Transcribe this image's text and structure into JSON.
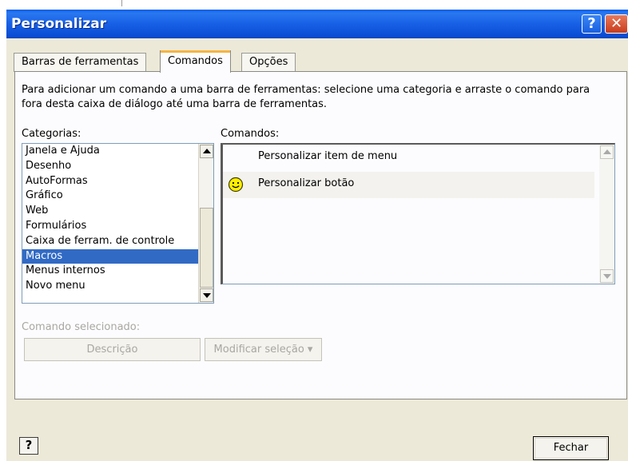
{
  "window": {
    "title": "Personalizar",
    "help_glyph": "?",
    "close_glyph": "✕"
  },
  "tabs": [
    {
      "label": "Barras de ferramentas",
      "selected": false
    },
    {
      "label": "Comandos",
      "selected": true
    },
    {
      "label": "Opções",
      "selected": false
    }
  ],
  "instructions": "Para adicionar um comando a uma barra de ferramentas: selecione uma categoria e arraste o comando para fora desta caixa de diálogo até uma barra de ferramentas.",
  "categories": {
    "label": "Categorias:",
    "items": [
      "Janela e Ajuda",
      "Desenho",
      "AutoFormas",
      "Gráfico",
      "Web",
      "Formulários",
      "Caixa de ferram. de controle",
      "Macros",
      "Menus internos",
      "Novo menu"
    ],
    "selected": "Macros"
  },
  "commands": {
    "label": "Comandos:",
    "items": [
      {
        "label": "Personalizar item de menu",
        "icon": "none"
      },
      {
        "label": "Personalizar botão",
        "icon": "smiley-face-icon"
      }
    ]
  },
  "selected_command": {
    "label": "Comando selecionado:",
    "description_button": "Descrição",
    "modify_button": "Modificar seleção ▾"
  },
  "footer": {
    "help_glyph": "?",
    "close_button": "Fechar"
  }
}
